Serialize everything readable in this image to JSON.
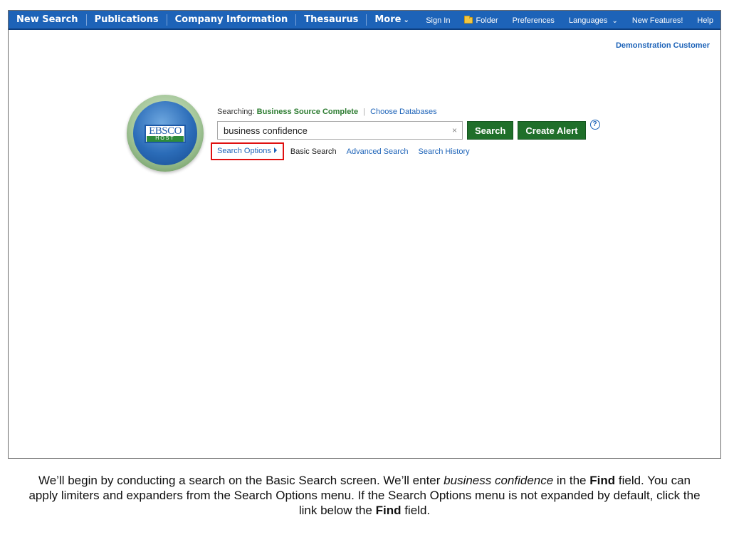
{
  "nav": {
    "main": [
      {
        "label": "New Search"
      },
      {
        "label": "Publications"
      },
      {
        "label": "Company Information"
      },
      {
        "label": "Thesaurus"
      },
      {
        "label": "More",
        "chevron": "⌄"
      }
    ],
    "right": [
      {
        "label": "Sign In"
      },
      {
        "label": "Folder",
        "icon": "folder-icon"
      },
      {
        "label": "Preferences"
      },
      {
        "label": "Languages",
        "chevron": "⌄"
      },
      {
        "label": "New Features!"
      },
      {
        "label": "Help"
      }
    ]
  },
  "account": {
    "name": "Demonstration Customer"
  },
  "logo": {
    "word": "EBSCO",
    "sub": "HOST"
  },
  "search": {
    "searching_label": "Searching:",
    "database": "Business Source Complete",
    "choose_databases": "Choose Databases",
    "find_value": "business confidence",
    "clear_glyph": "×",
    "search_button": "Search",
    "create_alert_button": "Create Alert",
    "help_glyph": "?"
  },
  "links": {
    "search_options": "Search Options",
    "basic_search": "Basic Search",
    "advanced_search": "Advanced Search",
    "search_history": "Search History"
  },
  "caption": {
    "part1": "We’ll begin by conducting a search on the Basic Search screen. We’ll enter ",
    "italic": "business confidence",
    "part2": " in the ",
    "bold1": "Find",
    "part3": " field. You can apply limiters and expanders from the Search Options menu. If the Search Options menu is not expanded by default, click the link below the ",
    "bold2": "Find",
    "part4": " field."
  },
  "colors": {
    "nav_bg": "#1d63b8",
    "green_button": "#1f6f2a",
    "link": "#1d63b8",
    "highlight_box": "#e01010"
  }
}
